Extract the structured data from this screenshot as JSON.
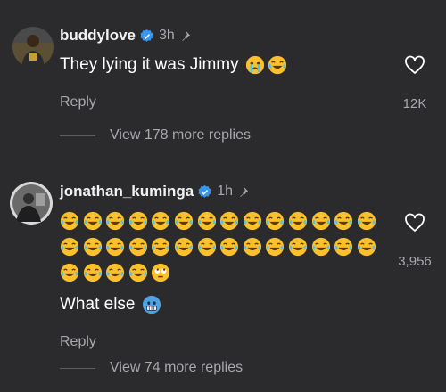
{
  "comments": [
    {
      "username": "buddylove",
      "time": "3h",
      "text": "They lying it was Jimmy",
      "text_emojis": [
        "crying-face",
        "laughing-crying"
      ],
      "reply_label": "Reply",
      "likes": "12K",
      "more_replies": "View 178 more replies"
    },
    {
      "username": "jonathan_kuminga",
      "time": "1h",
      "emoji_rows": [
        [
          "laughing-crying",
          "laughing-crying",
          "laughing-crying",
          "laughing-crying",
          "laughing-crying",
          "laughing-crying",
          "laughing-crying",
          "laughing-crying",
          "laughing-crying",
          "laughing-crying",
          "laughing-crying",
          "laughing-crying",
          "laughing-crying",
          "laughing-crying"
        ],
        [
          "laughing-crying",
          "laughing-crying",
          "laughing-crying",
          "laughing-crying",
          "laughing-crying",
          "laughing-crying",
          "laughing-crying",
          "laughing-crying",
          "laughing-crying",
          "laughing-crying",
          "laughing-crying",
          "laughing-crying",
          "laughing-crying",
          "laughing-crying"
        ],
        [
          "laughing-crying",
          "laughing-crying",
          "laughing-crying",
          "laughing-crying",
          "eye-roll"
        ]
      ],
      "text": "What else",
      "text_emojis": [
        "cold-face"
      ],
      "reply_label": "Reply",
      "likes": "3,956",
      "more_replies": "View 74 more replies"
    }
  ],
  "colors": {
    "background": "#2b2b2e",
    "verified": "#3797f0",
    "secondary_text": "#a8a8ad",
    "avatar_ring": "#d9d9d9"
  }
}
